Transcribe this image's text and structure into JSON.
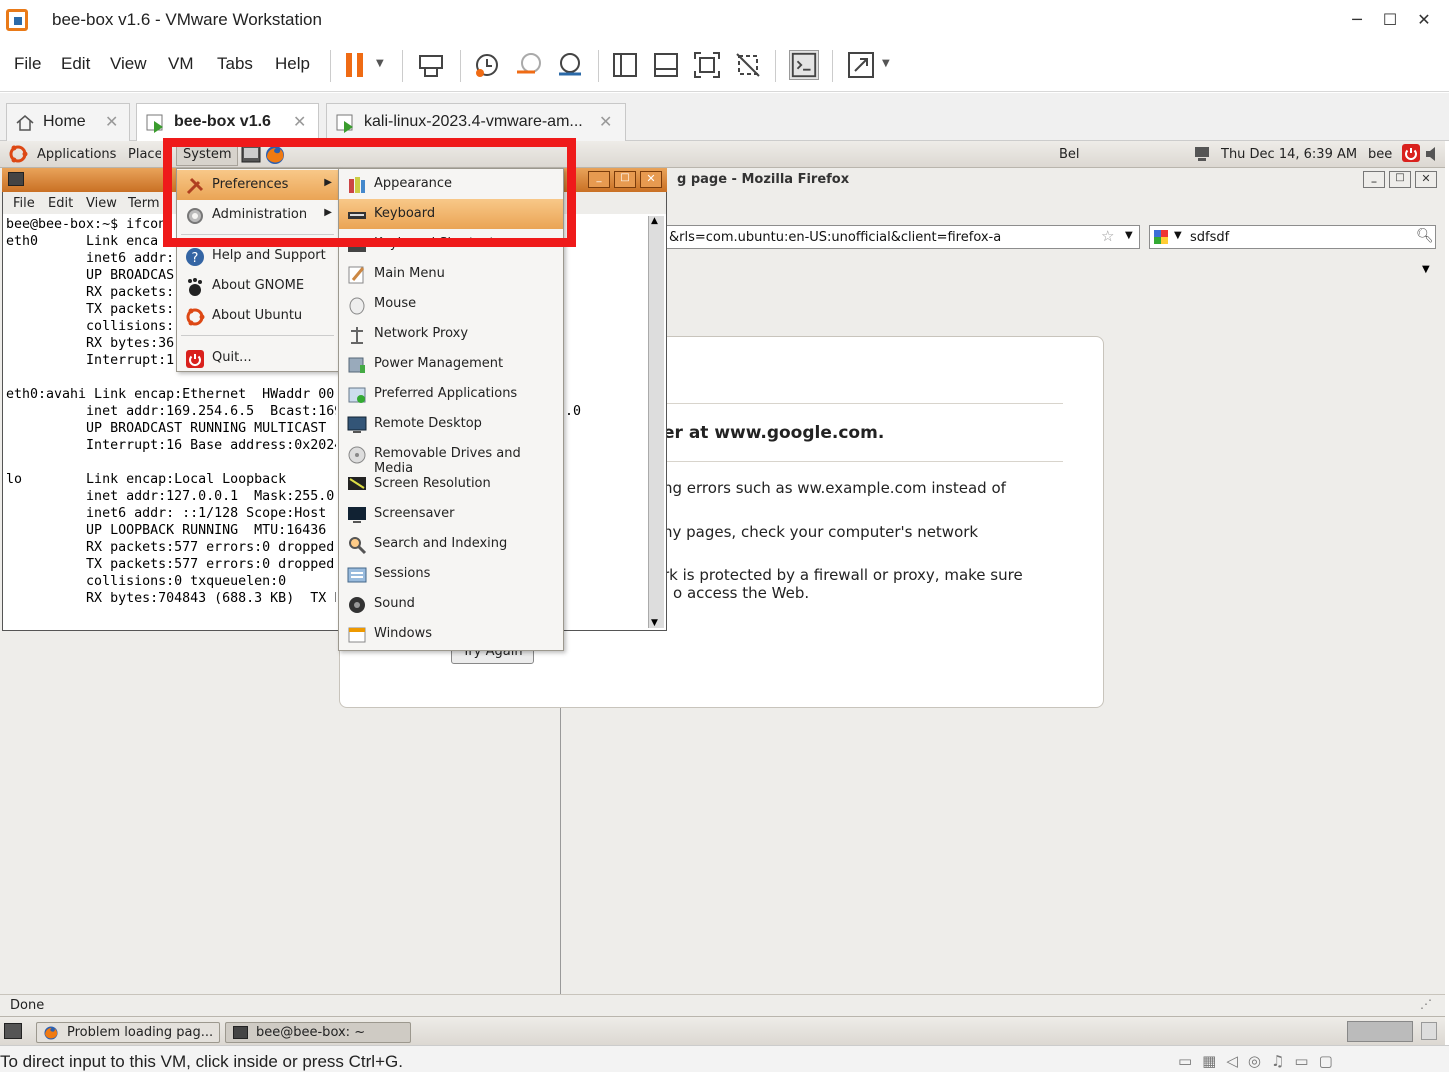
{
  "window": {
    "title": "bee-box v1.6 - VMware Workstation",
    "controls": {
      "minimize": "─",
      "maximize": "☐",
      "close": "✕"
    }
  },
  "vm_menu": [
    "File",
    "Edit",
    "View",
    "VM",
    "Tabs",
    "Help"
  ],
  "tabs": [
    {
      "label": "Home",
      "icon": "home-icon"
    },
    {
      "label": "bee-box v1.6",
      "icon": "vm-running-icon",
      "active": true
    },
    {
      "label": "kali-linux-2023.4-vmware-am...",
      "icon": "vm-running-icon"
    }
  ],
  "gnome_panel": {
    "applications": "Applications",
    "places": "Places",
    "system": "System",
    "keyboard_indicator": "Bel",
    "clock": "Thu Dec 14,  6:39 AM",
    "user": "bee"
  },
  "system_menu": {
    "items": [
      {
        "label": "Preferences",
        "icon": "preferences-icon",
        "submenu": true,
        "highlighted": true
      },
      {
        "label": "Administration",
        "icon": "administration-icon",
        "submenu": true
      },
      {
        "label": "Help and Support",
        "icon": "help-icon"
      },
      {
        "label": "About GNOME",
        "icon": "gnome-foot-icon"
      },
      {
        "label": "About Ubuntu",
        "icon": "ubuntu-icon"
      },
      {
        "label": "Quit...",
        "icon": "power-icon"
      }
    ]
  },
  "preferences_menu": {
    "items": [
      {
        "label": "Appearance",
        "icon": "appearance-icon"
      },
      {
        "label": "Keyboard",
        "icon": "keyboard-icon",
        "highlighted": true
      },
      {
        "label": "Keyboard Shortcuts",
        "icon": "keyboard-shortcuts-icon"
      },
      {
        "label": "Main Menu",
        "icon": "main-menu-icon"
      },
      {
        "label": "Mouse",
        "icon": "mouse-icon"
      },
      {
        "label": "Network Proxy",
        "icon": "network-proxy-icon"
      },
      {
        "label": "Power Management",
        "icon": "power-management-icon"
      },
      {
        "label": "Preferred Applications",
        "icon": "preferred-apps-icon"
      },
      {
        "label": "Remote Desktop",
        "icon": "remote-desktop-icon"
      },
      {
        "label": "Removable Drives and Media",
        "icon": "removable-drives-icon"
      },
      {
        "label": "Screen Resolution",
        "icon": "screen-resolution-icon"
      },
      {
        "label": "Screensaver",
        "icon": "screensaver-icon"
      },
      {
        "label": "Search and Indexing",
        "icon": "search-indexing-icon"
      },
      {
        "label": "Sessions",
        "icon": "sessions-icon"
      },
      {
        "label": "Sound",
        "icon": "sound-icon"
      },
      {
        "label": "Windows",
        "icon": "windows-icon"
      }
    ]
  },
  "terminal": {
    "menu": [
      "File",
      "Edit",
      "View",
      "Term"
    ],
    "lines_left": [
      "bee@bee-box:~$ ifcon",
      "eth0      Link enca",
      "          inet6 addr:",
      "          UP BROADCAS",
      "          RX packets:",
      "          TX packets:",
      "          collisions:",
      "          RX bytes:36",
      "          Interrupt:1",
      "",
      "eth0:avahi Link encap:Ethernet  HWaddr 00",
      "          inet addr:169.254.6.5  Bcast:169",
      "          UP BROADCAST RUNNING MULTICAST",
      "          Interrupt:16 Base address:0x2024",
      "",
      "lo        Link encap:Local Loopback",
      "          inet addr:127.0.0.1  Mask:255.0",
      "          inet6 addr: ::1/128 Scope:Host",
      "          UP LOOPBACK RUNNING  MTU:16436",
      "          RX packets:577 errors:0 dropped",
      "          TX packets:577 errors:0 dropped",
      "          collisions:0 txqueuelen:0",
      "          RX bytes:704843 (688.3 KB)  TX b"
    ],
    "lines_right": [
      "",
      "",
      "",
      "",
      "",
      "",
      "",
      "",
      "",
      "",
      "",
      ".0"
    ]
  },
  "firefox": {
    "title": "g page - Mozilla Firefox",
    "url": "&rls=com.ubuntu:en-US:unofficial&client=firefox-a",
    "search": "sdfsdf",
    "error_lines": [
      "er at www.google.com.",
      "ng errors such as ww.example.com instead of",
      "ny pages, check your computer's network",
      "rk is protected by a firewall or proxy, make sure",
      "o access the Web."
    ],
    "try_again": "Try Again",
    "status": "Done"
  },
  "taskbar": [
    {
      "label": "Problem loading pag...",
      "icon": "firefox-icon"
    },
    {
      "label": "bee@bee-box: ~",
      "icon": "terminal-icon"
    }
  ],
  "hint": "To direct input to this VM, click inside or press Ctrl+G.",
  "colors": {
    "highlight": "#eaa455",
    "annotation_red": "#ef1a1a",
    "vmware_orange": "#e97a18"
  }
}
